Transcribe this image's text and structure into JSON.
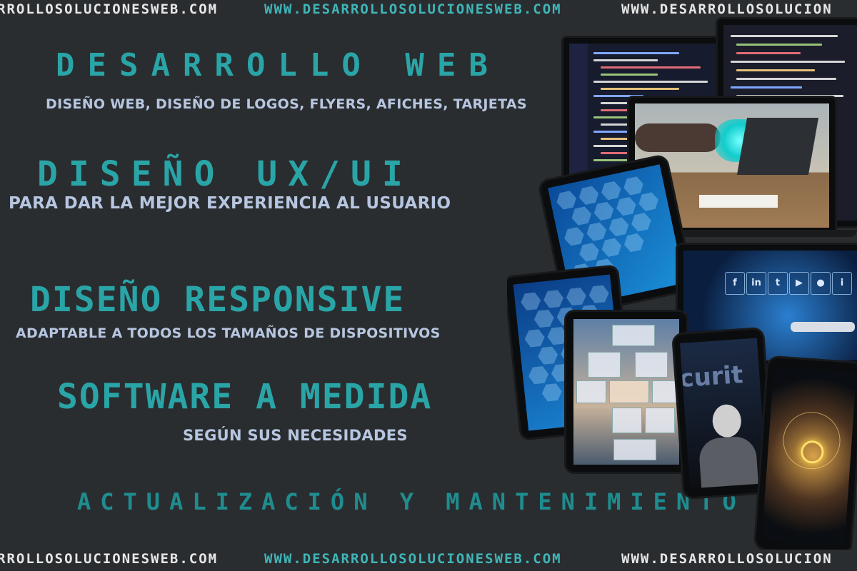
{
  "watermark": {
    "top": [
      "RROLLOSOLUCIONESWEB.COM",
      "WWW.DESARROLLOSOLUCIONESWEB.COM",
      "WWW.DESARROLLOSOLUCION"
    ],
    "bottom": [
      "RROLLOSOLUCIONESWEB.COM",
      "WWW.DESARROLLOSOLUCIONESWEB.COM",
      "WWW.DESARROLLOSOLUCION"
    ]
  },
  "services": [
    {
      "title": "DESARROLLO WEB",
      "subtitle": "DISEÑO WEB, DISEÑO DE LOGOS, FLYERS, AFICHES, TARJETAS"
    },
    {
      "title": "DISEÑO UX/UI",
      "subtitle": "PARA DAR LA MEJOR EXPERIENCIA AL USUARIO"
    },
    {
      "title": "DISEÑO RESPONSIVE",
      "subtitle": "ADAPTABLE A TODOS LOS TAMAÑOS DE DISPOSITIVOS"
    },
    {
      "title": "SOFTWARE A MEDIDA",
      "subtitle": "SEGÚN SUS NECESIDADES"
    }
  ],
  "footer_tagline": "ACTUALIZACIÓN Y MANTENIMIENTO",
  "colors": {
    "background": "#2a2d30",
    "headline": "#2aa5a7",
    "subtitle": "#b7c6e0",
    "watermark_dim": "#e6e6e6",
    "watermark_teal": "#3fb6b8"
  },
  "devices": {
    "tablet_social_icons": [
      "f",
      "in",
      "t",
      "▶",
      "●",
      "i"
    ],
    "phone_security_word": "curit"
  }
}
